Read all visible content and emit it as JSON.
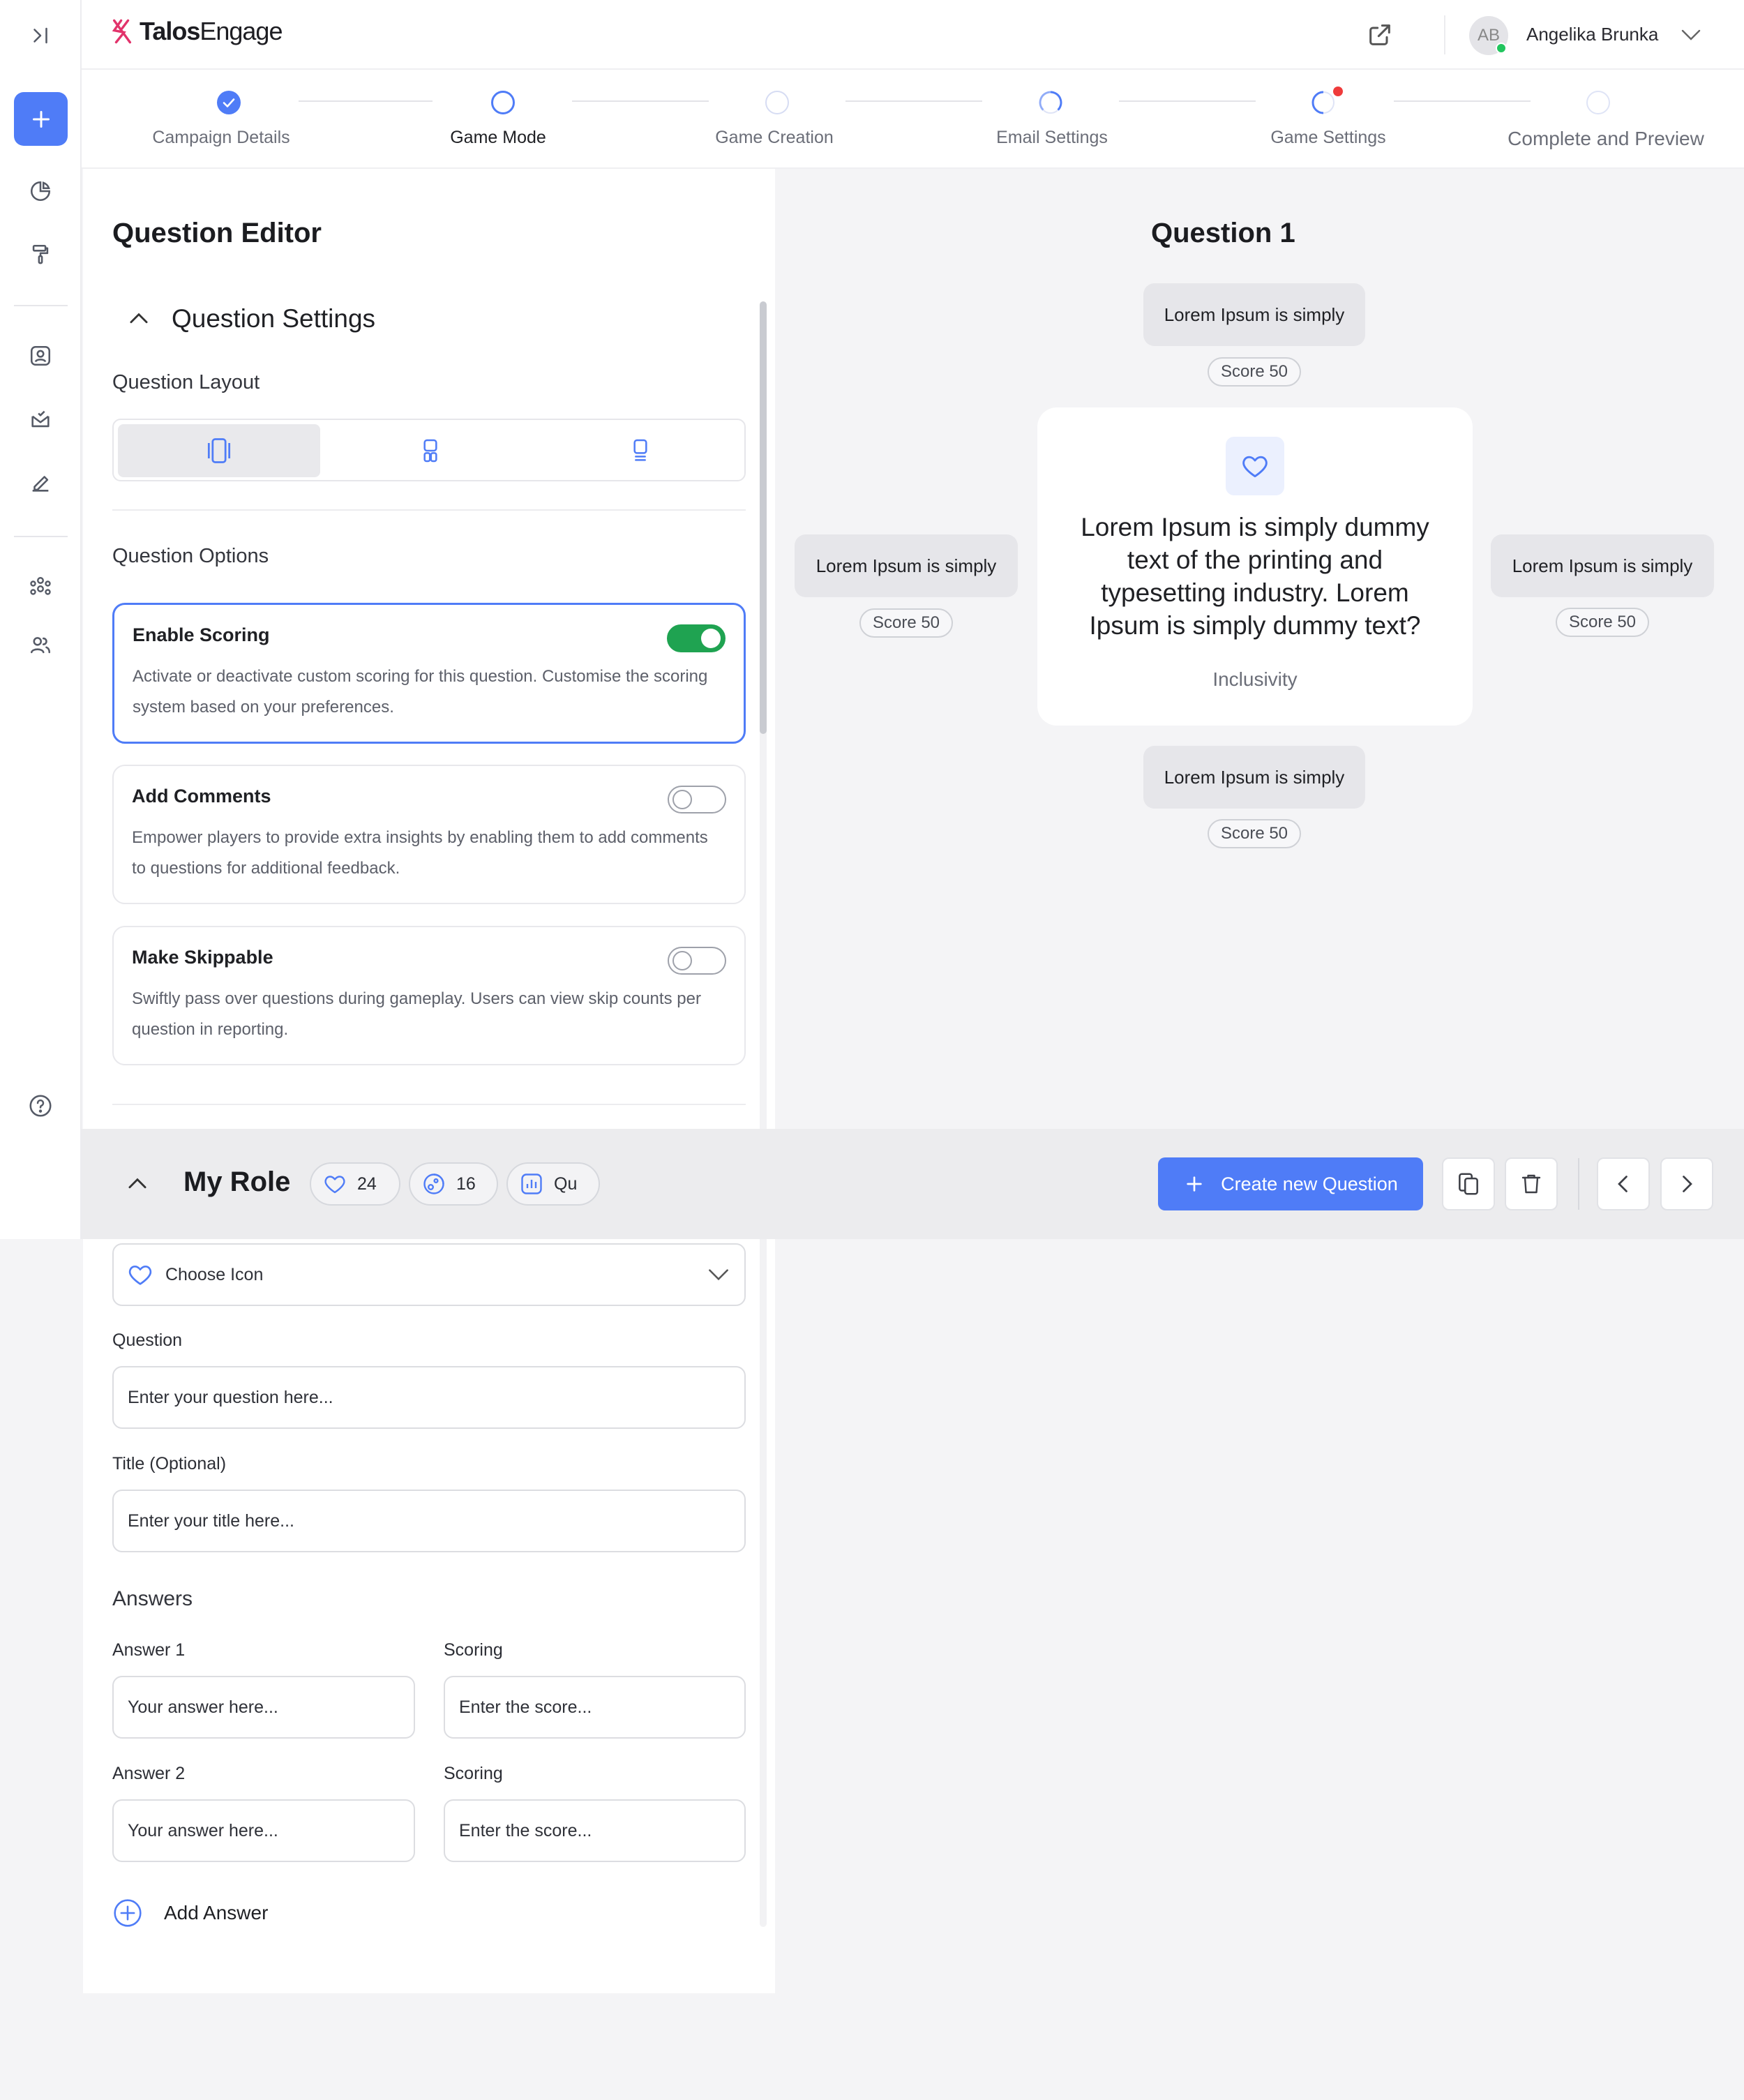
{
  "brand": {
    "name_bold": "Talos",
    "name_light": "Engage",
    "accent": "#4f7cf7",
    "logo_color": "#e2336b"
  },
  "user": {
    "initials": "AB",
    "name": "Angelika Brunka",
    "status_color": "#22c55e"
  },
  "sidebar": {
    "items": [
      {
        "icon": "collapse-icon"
      },
      {
        "icon": "add-icon"
      },
      {
        "icon": "analytics-icon"
      },
      {
        "icon": "paint-roller-icon"
      },
      {
        "icon": "user-card-icon"
      },
      {
        "icon": "mail-check-icon"
      },
      {
        "icon": "pen-icon"
      },
      {
        "icon": "team-icon"
      },
      {
        "icon": "users-icon"
      },
      {
        "icon": "help-icon"
      }
    ]
  },
  "stepper": {
    "steps": [
      {
        "label": "Campaign Details",
        "state": "done"
      },
      {
        "label": "Game Mode",
        "state": "current"
      },
      {
        "label": "Game Creation",
        "state": "pending"
      },
      {
        "label": "Email Settings",
        "state": "partial"
      },
      {
        "label": "Game Settings",
        "state": "partial-alert"
      },
      {
        "label": "Complete and Preview",
        "state": "pending"
      }
    ]
  },
  "editor": {
    "title": "Question Editor",
    "settings_title": "Question Settings",
    "layout_label": "Question Layout",
    "layout_options": [
      "layout-carousel-icon",
      "layout-grid-icon",
      "layout-list-icon"
    ],
    "options_label": "Question Options",
    "options": [
      {
        "title": "Enable Scoring",
        "desc": "Activate or deactivate custom scoring for this question. Customise the scoring system based on your preferences.",
        "enabled": true
      },
      {
        "title": "Add Comments",
        "desc": "Empower players to provide extra insights by enabling them to add comments to questions for additional feedback.",
        "enabled": false
      },
      {
        "title": "Make Skippable",
        "desc": "Swiftly pass over questions during gameplay. Users can view skip counts per question in reporting.",
        "enabled": false
      }
    ]
  },
  "preview": {
    "title": "Question 1",
    "answers": [
      {
        "text": "Lorem Ipsum is simply",
        "score": "Score 50"
      },
      {
        "text": "Lorem Ipsum is simply",
        "score": "Score 50"
      },
      {
        "text": "Lorem Ipsum is simply",
        "score": "Score 50"
      },
      {
        "text": "Lorem Ipsum is simply",
        "score": "Score 50"
      }
    ],
    "question_text": "Lorem Ipsum is simply dummy text of the printing and typesetting industry. Lorem Ipsum is simply dummy text?",
    "category": "Inclusivity"
  },
  "band": {
    "title": "My Role",
    "pills": [
      {
        "icon": "heart-icon",
        "value": "24"
      },
      {
        "icon": "palette-icon",
        "value": "16"
      },
      {
        "icon": "chart-icon",
        "value": "Qu"
      }
    ],
    "create_label": "Create new Question"
  },
  "form": {
    "icon_select": "Choose Icon",
    "question_label": "Question",
    "question_placeholder": "Enter your question here...",
    "title_label": "Title (Optional)",
    "title_placeholder": "Enter your title here...",
    "answers_title": "Answers",
    "answer_rows": [
      {
        "label": "Answer 1",
        "placeholder": "Your answer here...",
        "score_label": "Scoring",
        "score_placeholder": "Enter the score..."
      },
      {
        "label": "Answer 2",
        "placeholder": "Your answer here...",
        "score_label": "Scoring",
        "score_placeholder": "Enter the score..."
      }
    ],
    "add_answer": "Add Answer"
  }
}
